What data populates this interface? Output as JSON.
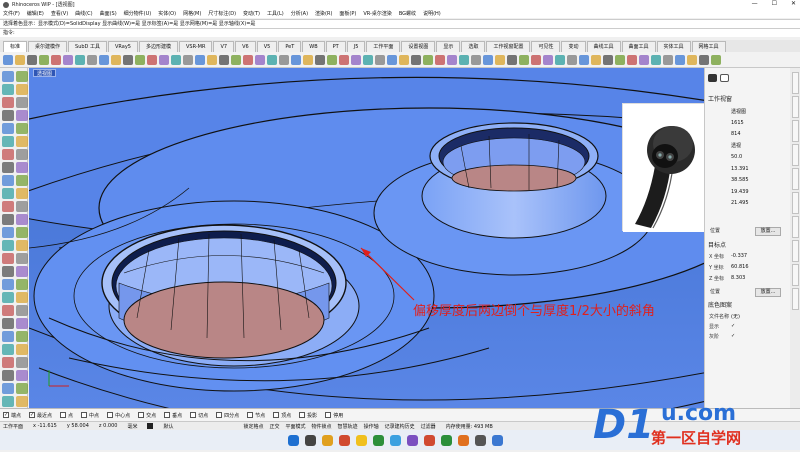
{
  "window": {
    "title": "Rhinoceros WIP - [透视图]",
    "controls": [
      "—",
      "☐",
      "✕"
    ]
  },
  "menubar": [
    "文件(F)",
    "编辑(E)",
    "查看(V)",
    "曲线(C)",
    "曲面(S)",
    "细分物件(U)",
    "实体(O)",
    "网格(M)",
    "尺寸标注(D)",
    "变动(T)",
    "工具(L)",
    "分析(A)",
    "渲染(R)",
    "面板(P)",
    "VR-桌尔渲染",
    "BG螺纹",
    "说明(H)"
  ],
  "command_history": "选择着色显示：显示模式(D)=SolidDisplay  显示曲线(W)=是  显示标签(A)=是  显示网格(M)=是  显示轴线(X)=是",
  "command_prompt": "指令:",
  "tabs": [
    "标准",
    "桌尔建模作",
    "SubD 工具",
    "VRay5",
    "多边形建模",
    "VSR-MR",
    "V7",
    "V6",
    "V5",
    "PeT",
    "WB",
    "PT",
    "J5",
    "工作平面",
    "设置视图",
    "显示",
    "选取",
    "工作视窗配置",
    "可见性",
    "变动",
    "曲线工具",
    "曲面工具",
    "实体工具",
    "网格工具"
  ],
  "active_tab_index": 0,
  "toolbar_icons": [
    "new-icon",
    "open-icon",
    "save-icon",
    "print-icon",
    "undo-icon",
    "redo-icon",
    "pan-icon",
    "rotate-icon",
    "zoom-icon",
    "zoom-window-icon",
    "zoom-extents-icon",
    "select-icon",
    "layer-icon",
    "properties-icon",
    "render-icon",
    "material-icon"
  ],
  "viewport": {
    "label": "透视图",
    "annotation": "偏移厚度后两边倒个与厚度1/2大小的斜角"
  },
  "properties_panel": {
    "header": "工作视窗",
    "rows": [
      {
        "label": "",
        "value": "透视图"
      },
      {
        "label": "",
        "value": "1615"
      },
      {
        "label": "",
        "value": "814"
      },
      {
        "label": "",
        "value": "透视"
      },
      {
        "label": "",
        "value": "50.0"
      },
      {
        "label": "",
        "value": "13.391"
      },
      {
        "label": "",
        "value": "38.585"
      },
      {
        "label": "",
        "value": "19.439"
      },
      {
        "label": "",
        "value": "21.495"
      }
    ],
    "camera_pos_label": "位置",
    "camera_pos_btn": "放置...",
    "target_header": "目标点",
    "target": [
      {
        "label": "X 坐标",
        "value": "-0.337"
      },
      {
        "label": "Y 坐标",
        "value": "60.816"
      },
      {
        "label": "Z 坐标",
        "value": "8.303"
      }
    ],
    "target_pos_label": "位置",
    "target_pos_btn": "放置...",
    "wallpaper_header": "底色图案",
    "wallpaper": [
      {
        "label": "文件名称",
        "value": "(无)"
      },
      {
        "label": "显示",
        "value": "✓"
      },
      {
        "label": "灰阶",
        "value": "✓"
      }
    ]
  },
  "osnap": [
    "端点",
    "最近点",
    "点",
    "中点",
    "中心点",
    "交点",
    "垂点",
    "切点",
    "四分点",
    "节点",
    "顶点",
    "投影",
    "停用"
  ],
  "status": {
    "cplane": "工作平面",
    "x": "x -11.615",
    "y": "y 58.004",
    "z": "z 0.000",
    "units": "毫米",
    "layer": "默认",
    "modes": [
      "锁定格点",
      "正交",
      "平面模式",
      "物件锁点",
      "智慧轨迹",
      "操作轴",
      "记录建构历史",
      "过滤器"
    ],
    "memory": "内存使用量: 493 MB"
  },
  "taskbar_icons": [
    "start-icon",
    "search-icon",
    "chrome-icon",
    "folder-icon",
    "app1-icon",
    "app2-icon",
    "app3-icon",
    "app4-icon",
    "app5-icon",
    "app6-icon",
    "app7-icon",
    "app8-icon",
    "app9-icon"
  ],
  "watermark": {
    "logo": "D1",
    "site": "u.com",
    "slogan": "第一区自学网"
  },
  "colors": {
    "viewport_bg": "#4b78d4",
    "surface": "#5d8cf0",
    "hole_floor": "#b98686",
    "annotation": "#e0201c",
    "watermark_blue": "#2a6fd6"
  }
}
